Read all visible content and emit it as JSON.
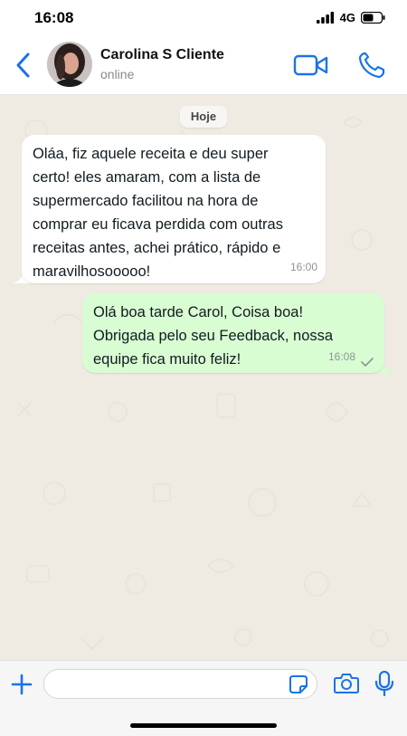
{
  "status_bar": {
    "time": "16:08",
    "network": "4G"
  },
  "header": {
    "contact_name": "Carolina S Cliente",
    "contact_status": "online",
    "icons": [
      "chevron-left-icon",
      "avatar",
      "video-call-icon",
      "phone-icon"
    ]
  },
  "chat": {
    "day_separator": "Hoje",
    "messages": [
      {
        "direction": "incoming",
        "text": "Oláa, fiz aquele receita e deu super\ncerto! eles amaram, com a lista de\nsupermercado facilitou na hora de\ncomprar eu ficava perdida com outras\nreceitas antes, achei prático, rápido e\nmaravilhosooooo!",
        "time": "16:00"
      },
      {
        "direction": "outgoing",
        "text": "Olá boa tarde Carol, Coisa boa!\nObrigada pelo seu Feedback, nossa\nequipe fica muito feliz!",
        "time": "16:08",
        "status": "sent"
      }
    ]
  },
  "input_bar": {
    "placeholder": "",
    "value": "",
    "icons": [
      "plus-icon",
      "sticker-icon",
      "camera-icon",
      "microphone-icon"
    ]
  },
  "colors": {
    "accent": "#1a73e8",
    "incoming_bubble": "#ffffff",
    "outgoing_bubble": "#d9fdd3",
    "chat_background": "#efeae2"
  }
}
